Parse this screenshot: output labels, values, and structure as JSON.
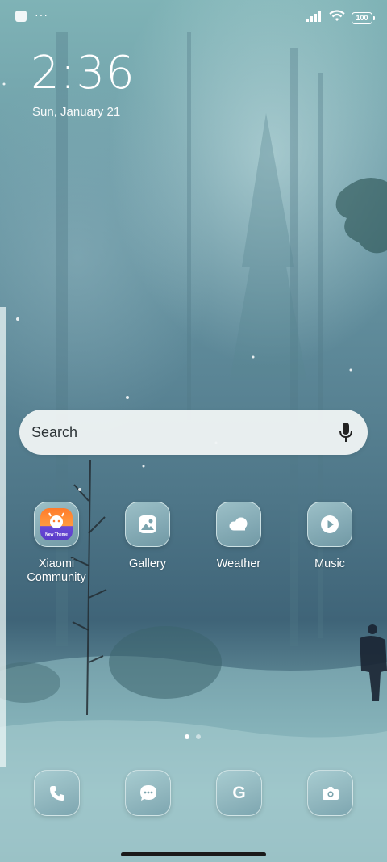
{
  "status_bar": {
    "battery_level": "100",
    "more_indicator": "···"
  },
  "lock": {
    "time": "2:36",
    "date": "Sun, January 21"
  },
  "search": {
    "label": "Search"
  },
  "apps": [
    {
      "name": "Xiaomi Community",
      "line1": "Xiaomi",
      "line2": "Community",
      "icon": "xiaomi-community-icon",
      "badge_text": "New Theme"
    },
    {
      "name": "Gallery",
      "icon": "gallery-icon"
    },
    {
      "name": "Weather",
      "icon": "weather-icon"
    },
    {
      "name": "Music",
      "icon": "music-icon"
    }
  ],
  "pages": {
    "total": 2,
    "current": 1
  },
  "dock": [
    {
      "icon": "phone-icon"
    },
    {
      "icon": "messages-icon"
    },
    {
      "icon": "google-icon",
      "glyph": "G"
    },
    {
      "icon": "camera-icon"
    }
  ],
  "colors": {
    "tile_border": "#e1f0f0",
    "search_bg": "#f0f4f4",
    "accent_orange": "#ff7b2a",
    "accent_purple": "#5a3cc8"
  }
}
